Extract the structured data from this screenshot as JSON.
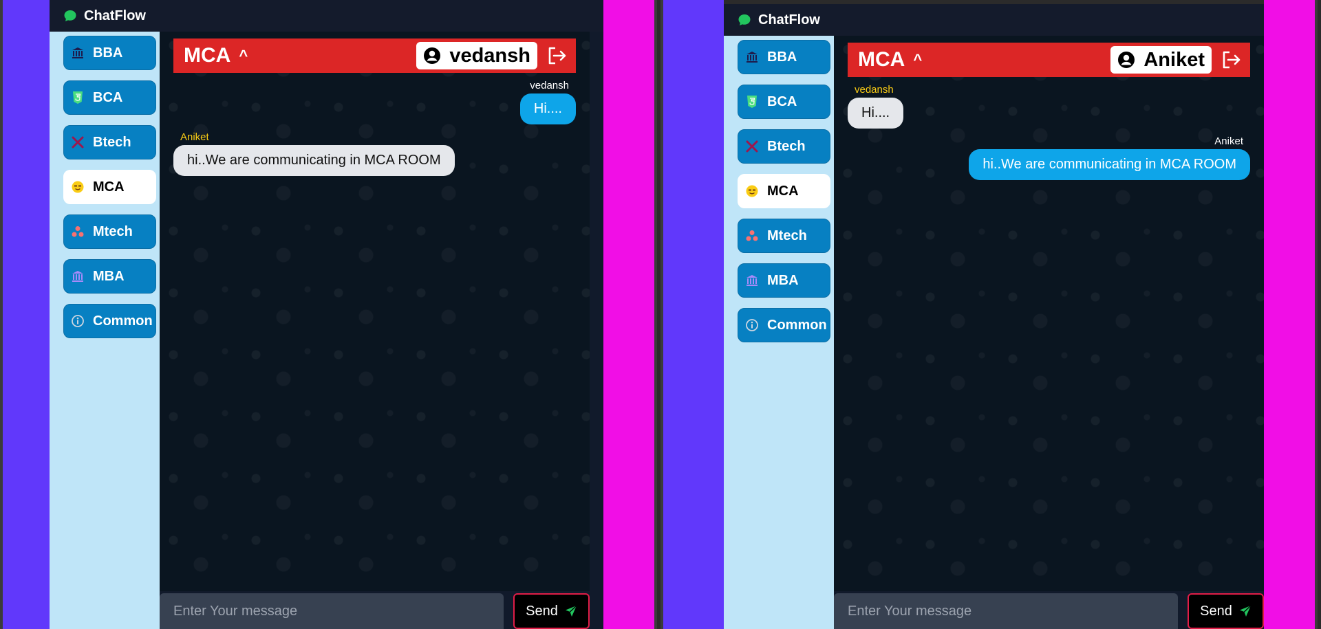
{
  "app_name": "ChatFlow",
  "rooms": [
    {
      "label": "BBA",
      "icon": "bank-icon"
    },
    {
      "label": "BCA",
      "icon": "html5-icon"
    },
    {
      "label": "Btech",
      "icon": "tools-icon"
    },
    {
      "label": "MCA",
      "icon": "smiley-icon",
      "active": true
    },
    {
      "label": "Mtech",
      "icon": "nodes-icon"
    },
    {
      "label": "MBA",
      "icon": "bank-icon"
    },
    {
      "label": "Common",
      "icon": "info-circle-icon"
    }
  ],
  "colors": {
    "left_stripe": "#6138fb",
    "right_stripe": "#f10ee6",
    "header_red": "#dc2626",
    "room_button": "#0780c2",
    "sidebar_bg": "#bfe5f8",
    "own_bubble": "#0ea5e9",
    "other_bubble": "#e5e7eb",
    "sender_yellow": "#facc15"
  },
  "windows": [
    {
      "header": {
        "room_title": "MCA",
        "caret": "^",
        "username": "vedansh"
      },
      "messages": [
        {
          "sender": "vedansh",
          "text": "Hi....",
          "side": "right"
        },
        {
          "sender": "Aniket",
          "text": "hi..We are communicating in MCA ROOM",
          "side": "left"
        }
      ],
      "input": {
        "placeholder": "Enter Your message",
        "value": ""
      },
      "send_label": "Send"
    },
    {
      "header": {
        "room_title": "MCA",
        "caret": "^",
        "username": "Aniket"
      },
      "messages": [
        {
          "sender": "vedansh",
          "text": "Hi....",
          "side": "left"
        },
        {
          "sender": "Aniket",
          "text": "hi..We are communicating in MCA ROOM",
          "side": "right"
        }
      ],
      "input": {
        "placeholder": "Enter Your message",
        "value": ""
      },
      "send_label": "Send"
    }
  ]
}
